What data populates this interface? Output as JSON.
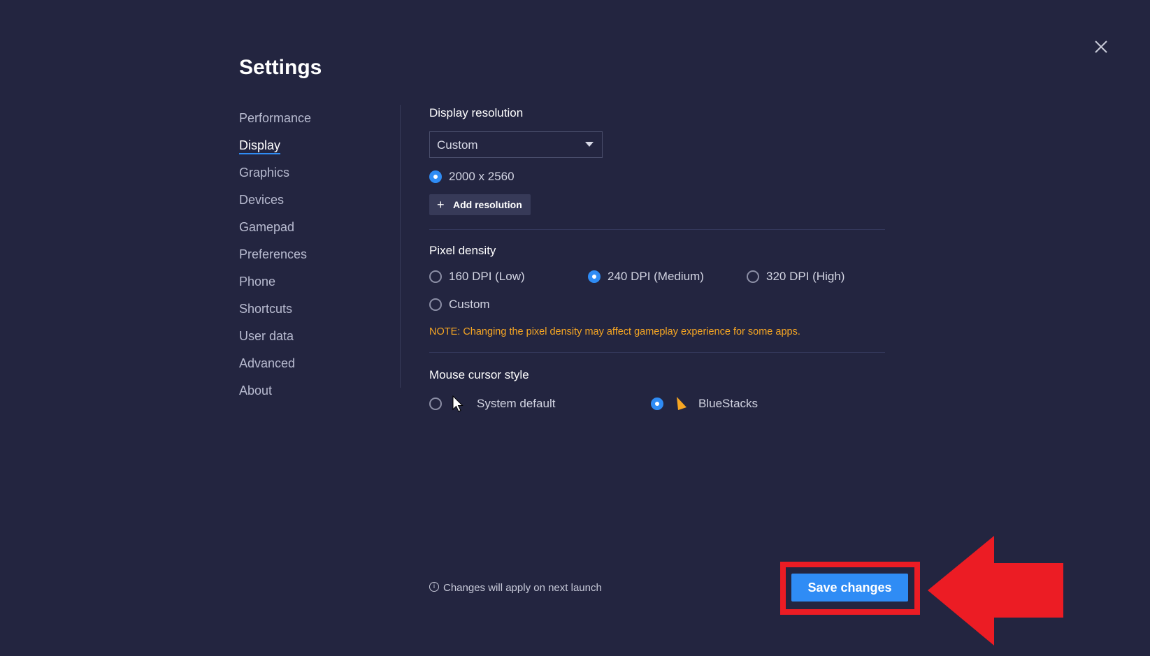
{
  "header": {
    "title": "Settings"
  },
  "nav": {
    "items": [
      {
        "label": "Performance",
        "active": false
      },
      {
        "label": "Display",
        "active": true
      },
      {
        "label": "Graphics",
        "active": false
      },
      {
        "label": "Devices",
        "active": false
      },
      {
        "label": "Gamepad",
        "active": false
      },
      {
        "label": "Preferences",
        "active": false
      },
      {
        "label": "Phone",
        "active": false
      },
      {
        "label": "Shortcuts",
        "active": false
      },
      {
        "label": "User data",
        "active": false
      },
      {
        "label": "Advanced",
        "active": false
      },
      {
        "label": "About",
        "active": false
      }
    ]
  },
  "display_resolution": {
    "label": "Display resolution",
    "dropdown_value": "Custom",
    "options": [
      {
        "label": "2000 x 2560",
        "selected": true
      }
    ],
    "add_button_label": "Add resolution"
  },
  "pixel_density": {
    "label": "Pixel density",
    "options": [
      {
        "label": "160 DPI (Low)",
        "selected": false
      },
      {
        "label": "240 DPI (Medium)",
        "selected": true
      },
      {
        "label": "320 DPI (High)",
        "selected": false
      },
      {
        "label": "Custom",
        "selected": false
      }
    ],
    "note": "NOTE: Changing the pixel density may affect gameplay experience for some apps."
  },
  "mouse_cursor": {
    "label": "Mouse cursor style",
    "options": [
      {
        "label": "System default",
        "selected": false,
        "icon": "arrow-cursor-icon"
      },
      {
        "label": "BlueStacks",
        "selected": true,
        "icon": "bluestacks-cursor-icon"
      }
    ]
  },
  "footer": {
    "note": "Changes will apply on next launch",
    "save_label": "Save changes"
  },
  "colors": {
    "background": "#232540",
    "accent": "#2f8cf5",
    "note": "#f6a623",
    "annotation": "#ec1c24"
  }
}
